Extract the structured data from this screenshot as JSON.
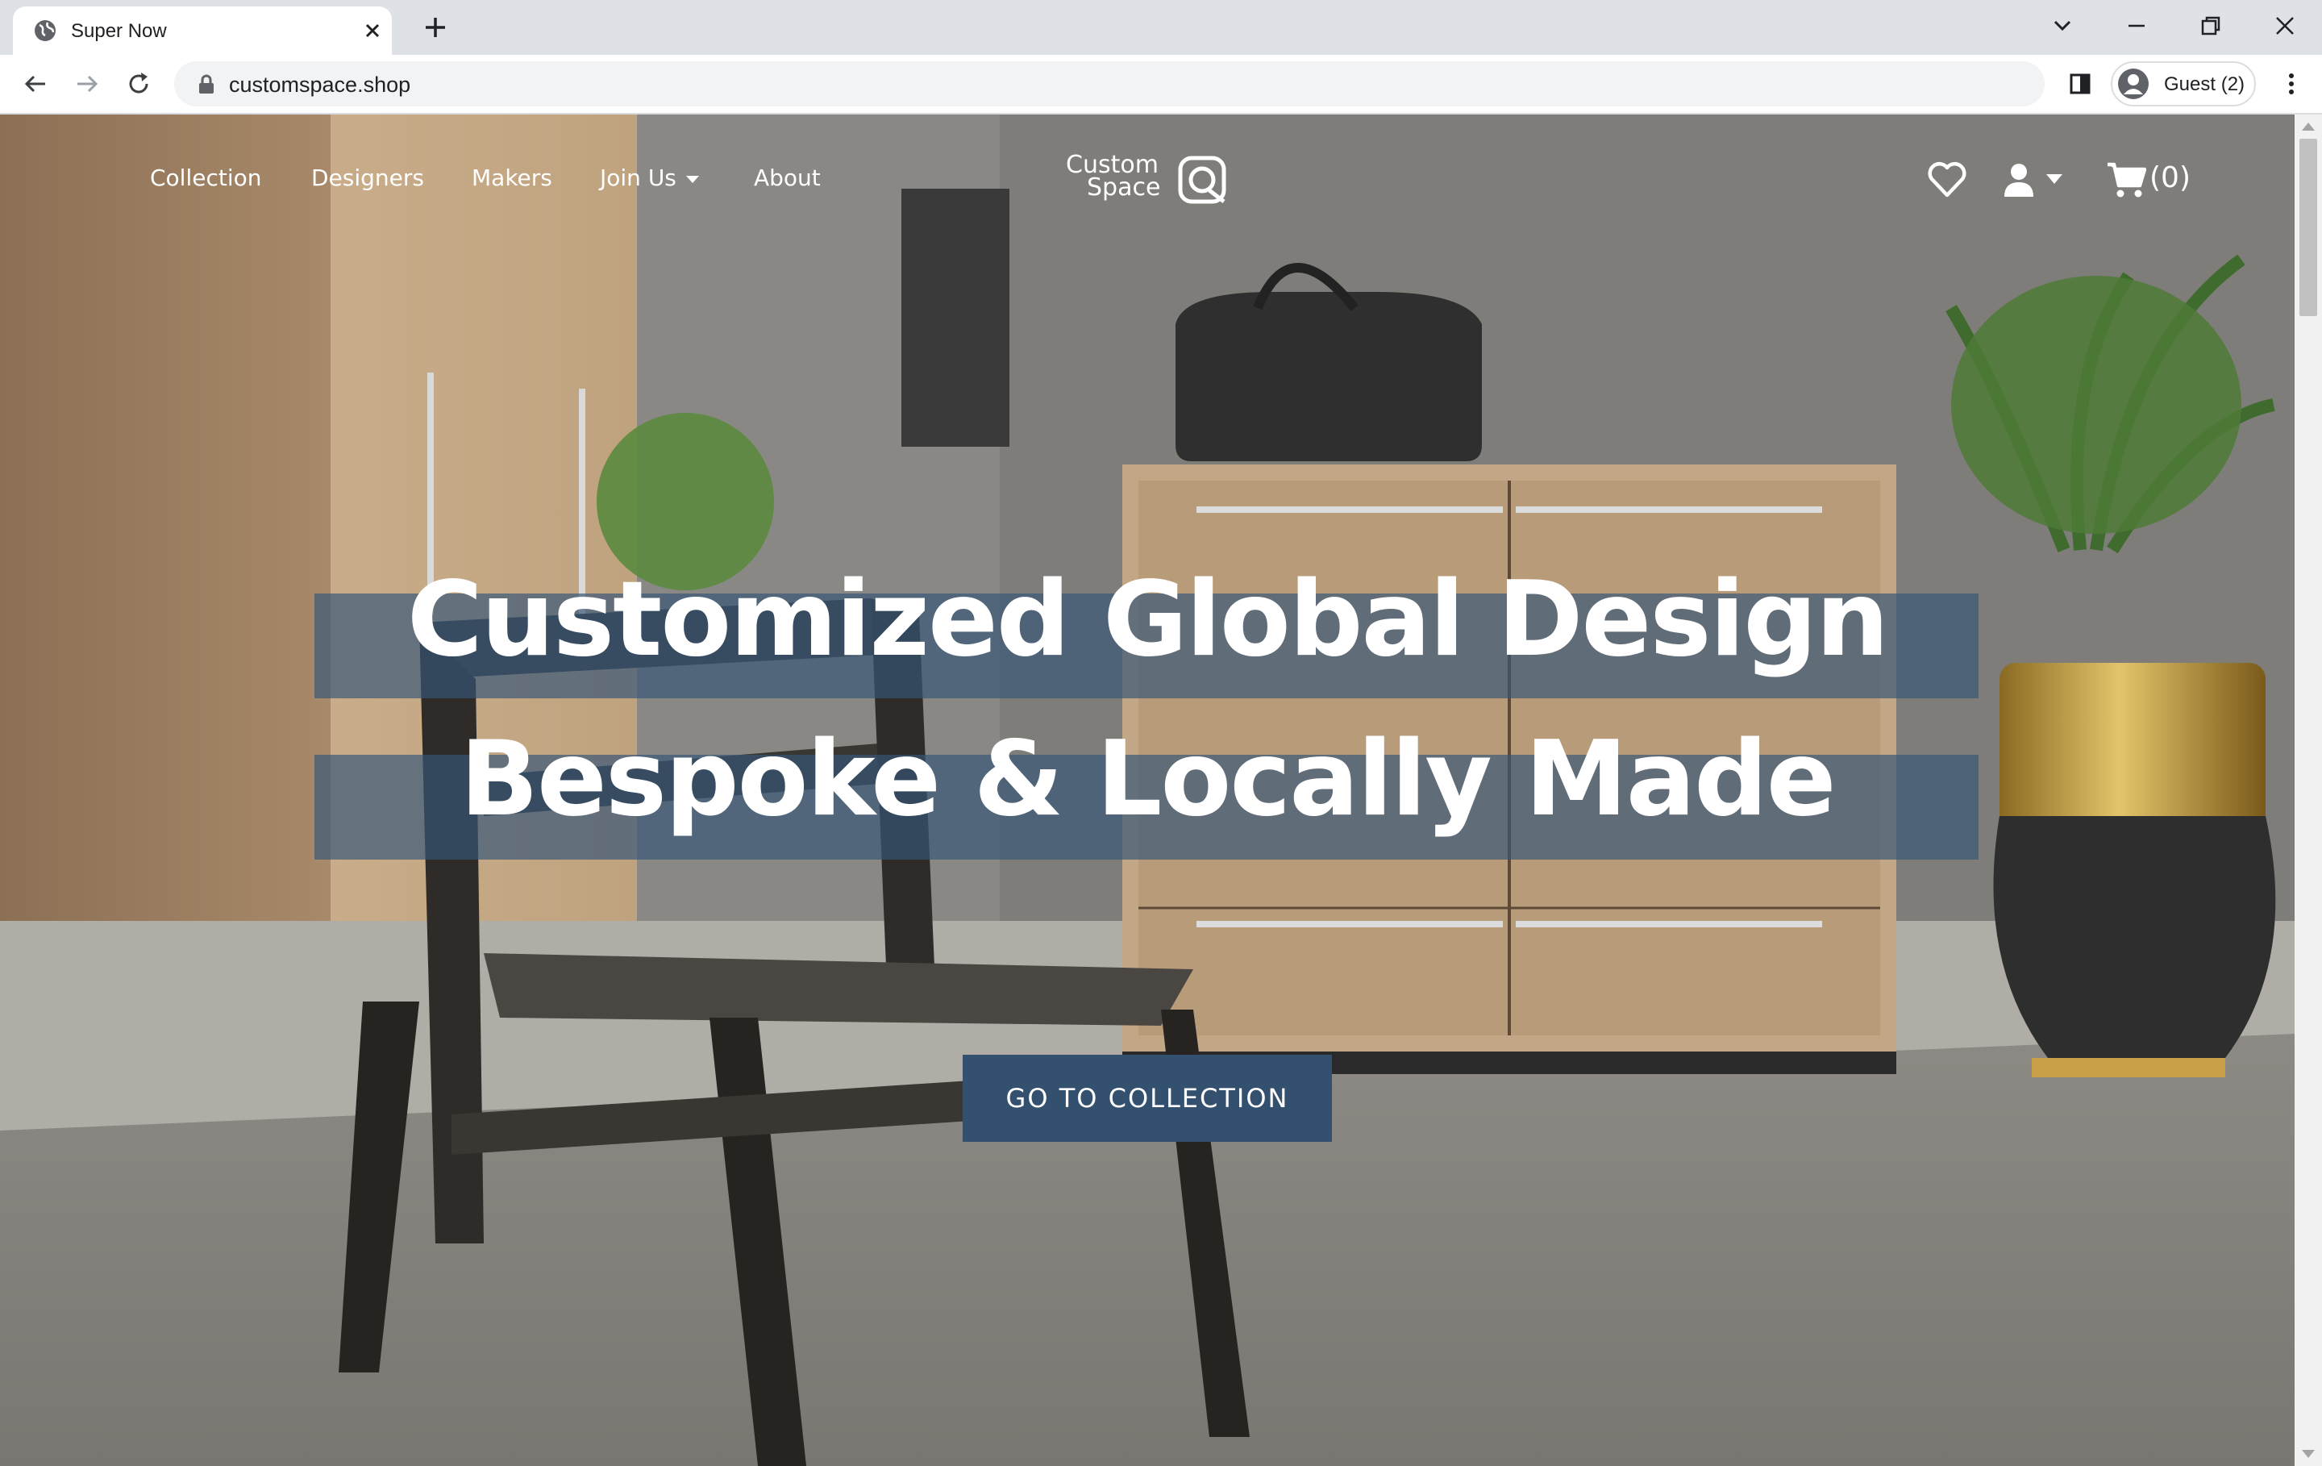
{
  "browser": {
    "tab_title": "Super Now",
    "url": "customspace.shop",
    "profile_label": "Guest (2)"
  },
  "site": {
    "nav": {
      "collection": "Collection",
      "designers": "Designers",
      "makers": "Makers",
      "join_us": "Join Us",
      "about": "About"
    },
    "logo": {
      "line1": "Custom",
      "line2": "Space"
    },
    "cart_count": "(0)",
    "headline_line1": "Customized Global Design",
    "headline_line2": "Bespoke & Locally Made",
    "cta_label": "GO TO COLLECTION"
  },
  "colors": {
    "accent": "#34506f",
    "headline_band": "#365678",
    "tabstrip": "#dee1e6"
  }
}
